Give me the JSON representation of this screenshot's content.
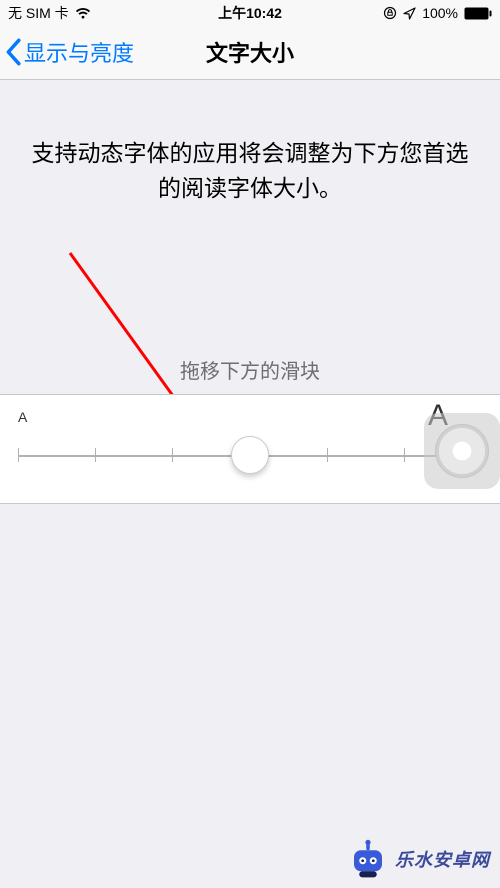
{
  "status": {
    "carrier": "无 SIM 卡",
    "time": "上午10:42",
    "battery_pct": "100%"
  },
  "nav": {
    "back_label": "显示与亮度",
    "title": "文字大小"
  },
  "body": {
    "description": "支持动态字体的应用将会调整为下方您首选的阅读字体大小。",
    "hint": "拖移下方的滑块"
  },
  "slider": {
    "small_label": "A",
    "large_label": "A",
    "ticks": 7,
    "value_index": 3
  },
  "watermark": {
    "text": "乐水安卓网"
  }
}
